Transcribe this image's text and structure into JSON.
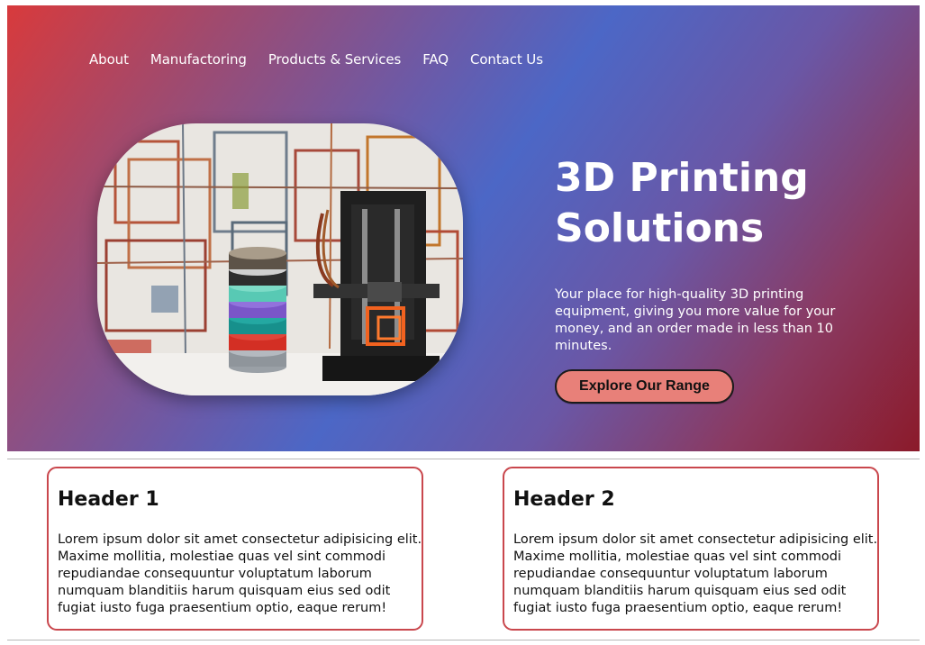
{
  "nav": {
    "items": [
      {
        "label": "About"
      },
      {
        "label": "Manufactoring"
      },
      {
        "label": "Products & Services"
      },
      {
        "label": "FAQ"
      },
      {
        "label": "Contact Us"
      }
    ]
  },
  "hero": {
    "title": "3D Printing Solutions",
    "description": "Your place for high-quality 3D printing equipment, giving you more value for your money, and an order made in less than 10 minutes.",
    "cta_label": "Explore Our Range",
    "image_subject": "3d-printer-with-filament-spools"
  },
  "cards": [
    {
      "header": "Header 1",
      "body": "Lorem ipsum dolor sit amet consectetur adipisicing elit. Maxime mollitia, molestiae quas vel sint commodi repudiandae consequuntur voluptatum laborum numquam blanditiis harum quisquam eius sed odit fugiat iusto fuga praesentium optio, eaque rerum!"
    },
    {
      "header": "Header 2",
      "body": "Lorem ipsum dolor sit amet consectetur adipisicing elit. Maxime mollitia, molestiae quas vel sint commodi repudiandae consequuntur voluptatum laborum numquam blanditiis harum quisquam eius sed odit fugiat iusto fuga praesentium optio, eaque rerum!"
    }
  ],
  "colors": {
    "accent_button": "#e88079",
    "card_border": "#c9474d",
    "gradient_red": "#d83a3c",
    "gradient_blue": "#4c67c6",
    "gradient_dark_red": "#8b1a2a"
  }
}
